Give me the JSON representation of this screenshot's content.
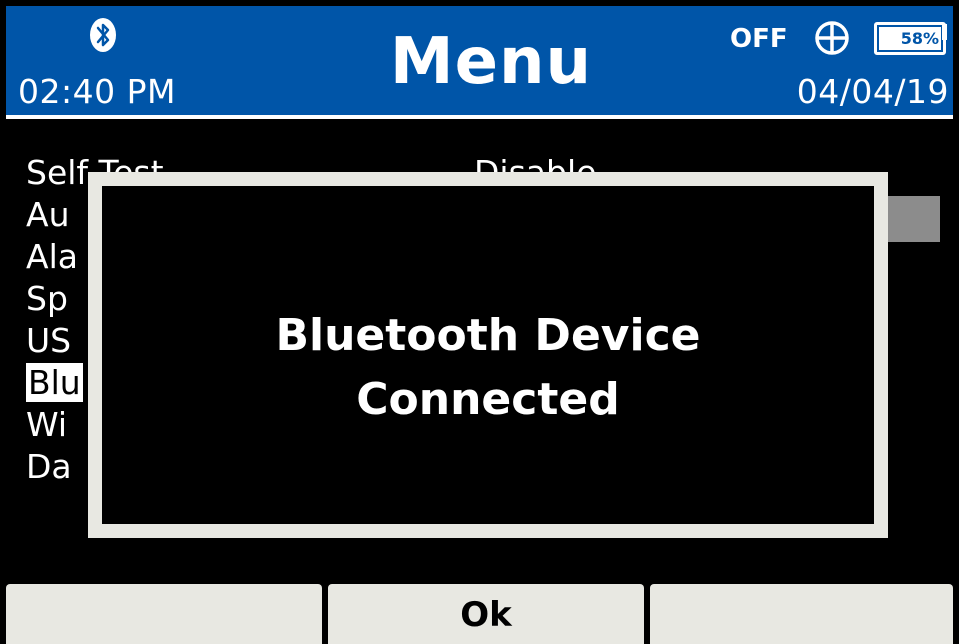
{
  "header": {
    "time": "02:40 PM",
    "title": "Menu",
    "gps_status": "OFF",
    "battery": "58%",
    "date": "04/04/19",
    "icons": {
      "bluetooth": "bluetooth-icon",
      "gps": "crosshair-icon",
      "battery": "battery-icon"
    },
    "colors": {
      "header_bg": "#0055a8",
      "text": "#ffffff"
    }
  },
  "menu": {
    "items": [
      {
        "label": "Self Test"
      },
      {
        "label": "Au"
      },
      {
        "label": "Ala"
      },
      {
        "label": "Sp"
      },
      {
        "label": "US"
      },
      {
        "label": "Blu"
      },
      {
        "label": "Wi"
      },
      {
        "label": "Da"
      }
    ],
    "selected_index": 5,
    "first_value": "Disable"
  },
  "dialog": {
    "line1": "Bluetooth Device",
    "line2": "Connected"
  },
  "softkeys": {
    "left": "",
    "middle": "Ok",
    "right": ""
  }
}
